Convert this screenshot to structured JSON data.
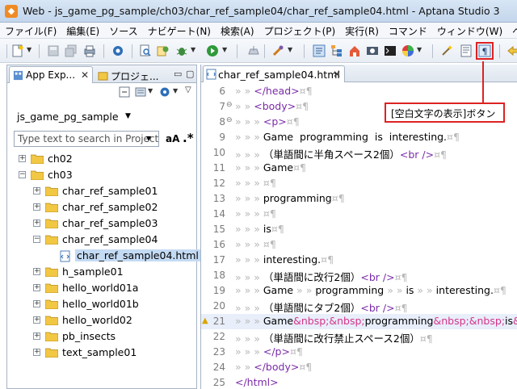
{
  "window": {
    "title": "Web - js_game_pg_sample/ch03/char_ref_sample04/char_ref_sample04.html - Aptana Studio 3"
  },
  "menu": [
    "ファイル(F)",
    "編集(E)",
    "ソース",
    "ナビゲート(N)",
    "検索(A)",
    "プロジェクト(P)",
    "実行(R)",
    "コマンド",
    "ウィンドウ(W)",
    "ヘル"
  ],
  "left_pane": {
    "tabs": [
      "App Exp...",
      "プロジェ..."
    ],
    "project_name": "js_game_pg_sample",
    "search": {
      "placeholder": "Type text to search in Project"
    },
    "search_options": {
      "aa": "aA",
      "regex": ".*"
    },
    "tree": [
      {
        "label": "ch02",
        "depth": 0,
        "expander": "+",
        "kind": "folder"
      },
      {
        "label": "ch03",
        "depth": 0,
        "expander": "-",
        "kind": "folder"
      },
      {
        "label": "char_ref_sample01",
        "depth": 1,
        "expander": "+",
        "kind": "folder"
      },
      {
        "label": "char_ref_sample02",
        "depth": 1,
        "expander": "+",
        "kind": "folder"
      },
      {
        "label": "char_ref_sample03",
        "depth": 1,
        "expander": "+",
        "kind": "folder"
      },
      {
        "label": "char_ref_sample04",
        "depth": 1,
        "expander": "-",
        "kind": "folder"
      },
      {
        "label": "char_ref_sample04.html",
        "depth": 2,
        "expander": "",
        "kind": "file",
        "selected": true
      },
      {
        "label": "h_sample01",
        "depth": 1,
        "expander": "+",
        "kind": "folder"
      },
      {
        "label": "hello_world01a",
        "depth": 1,
        "expander": "+",
        "kind": "folder"
      },
      {
        "label": "hello_world01b",
        "depth": 1,
        "expander": "+",
        "kind": "folder"
      },
      {
        "label": "hello_world02",
        "depth": 1,
        "expander": "+",
        "kind": "folder"
      },
      {
        "label": "pb_insects",
        "depth": 1,
        "expander": "+",
        "kind": "folder"
      },
      {
        "label": "text_sample01",
        "depth": 1,
        "expander": "+",
        "kind": "folder"
      }
    ]
  },
  "editor": {
    "tab_label": "char_ref_sample04.html",
    "lines": [
      {
        "n": "6",
        "fold": "",
        "html": "» » <span class='tag'>&lt;/head&gt;</span><span class='ws'>¤¶</span>"
      },
      {
        "n": "7",
        "fold": "⊖",
        "html": "» » <span class='tag'>&lt;body&gt;</span><span class='ws'>¤¶</span>"
      },
      {
        "n": "8",
        "fold": "⊖",
        "html": "» » » <span class='tag'>&lt;p&gt;</span><span class='ws'>¤¶</span>"
      },
      {
        "n": "9",
        "fold": "",
        "html": "» » » Game&nbsp; programming&nbsp; is&nbsp; interesting.<span class='ws'>¤¶</span>"
      },
      {
        "n": "10",
        "fold": "",
        "html": "» » » （単語間に半角スペース2個）<span class='tag'>&lt;br /&gt;</span><span class='ws'>¤¶</span>"
      },
      {
        "n": "11",
        "fold": "",
        "html": "» » » Game<span class='ws'>¤¶</span>"
      },
      {
        "n": "12",
        "fold": "",
        "html": "» » » <span class='ws'>¤¶</span>"
      },
      {
        "n": "13",
        "fold": "",
        "html": "» » » programming<span class='ws'>¤¶</span>"
      },
      {
        "n": "14",
        "fold": "",
        "html": "» » » <span class='ws'>¤¶</span>"
      },
      {
        "n": "15",
        "fold": "",
        "html": "» » » is<span class='ws'>¤¶</span>"
      },
      {
        "n": "16",
        "fold": "",
        "html": "» » » <span class='ws'>¤¶</span>"
      },
      {
        "n": "17",
        "fold": "",
        "html": "» » » interesting.<span class='ws'>¤¶</span>"
      },
      {
        "n": "18",
        "fold": "",
        "html": "» » » （単語間に改行2個）<span class='tag'>&lt;br /&gt;</span><span class='ws'>¤¶</span>"
      },
      {
        "n": "19",
        "fold": "",
        "html": "» » » Game<span class='ws'> » » </span>programming<span class='ws'> » » </span>is<span class='ws'> » » </span>interesting.<span class='ws'>¤¶</span>"
      },
      {
        "n": "20",
        "fold": "",
        "html": "» » » （単語間にタブ2個）<span class='tag'>&lt;br /&gt;</span><span class='ws'>¤¶</span>"
      },
      {
        "n": "21",
        "fold": "",
        "html": "» » » Game<span class='ent'>&amp;nbsp;&amp;nbsp;</span>programming<span class='ent'>&amp;nbsp;&amp;nbsp;</span>is<span class='ent'>&amp;n</span>",
        "warn": true,
        "highlight": true
      },
      {
        "n": "22",
        "fold": "",
        "html": "» » » （単語間に改行禁止スペース2個）<span class='ws'>¤¶</span>"
      },
      {
        "n": "23",
        "fold": "",
        "html": "» » » <span class='tag'>&lt;/p&gt;</span><span class='ws'>¤¶</span>"
      },
      {
        "n": "24",
        "fold": "",
        "html": "» » <span class='tag'>&lt;/body&gt;</span><span class='ws'>¤¶</span>"
      },
      {
        "n": "25",
        "fold": "",
        "html": "<span class='tag'>&lt;/html&gt;</span>"
      }
    ]
  },
  "annotation": {
    "callout_text": "[空白文字の表示]ボタン"
  }
}
